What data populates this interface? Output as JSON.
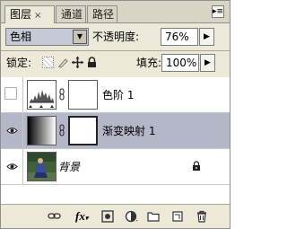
{
  "tabs": [
    {
      "label": "图层",
      "close": "×",
      "active": true
    },
    {
      "label": "通道",
      "active": false
    },
    {
      "label": "路径",
      "active": false
    }
  ],
  "panel_menu_icon": "panel-menu-icon",
  "blend_mode": "色相",
  "opacity": {
    "label": "不透明度:",
    "value": "76%"
  },
  "lock": {
    "label": "锁定:"
  },
  "fill": {
    "label": "填充:",
    "value": "100%"
  },
  "layers": [
    {
      "name": "色阶 1",
      "visible": false,
      "selected": false,
      "type": "levels-adjustment"
    },
    {
      "name": "渐变映射 1",
      "visible": true,
      "selected": true,
      "type": "gradient-map-adjustment"
    },
    {
      "name": "背景",
      "visible": true,
      "selected": false,
      "type": "image",
      "locked": true,
      "italic": true
    }
  ],
  "footer_icons": [
    "link-layers-icon",
    "fx-icon",
    "mask-icon",
    "adjustment-icon",
    "group-folder-icon",
    "new-layer-icon",
    "trash-icon"
  ],
  "footer_fx_text": "fx",
  "colors": {
    "panel_bg": "#ece9d8",
    "selected_row": "#b4b7c8",
    "blend_field": "#c5cad6"
  }
}
